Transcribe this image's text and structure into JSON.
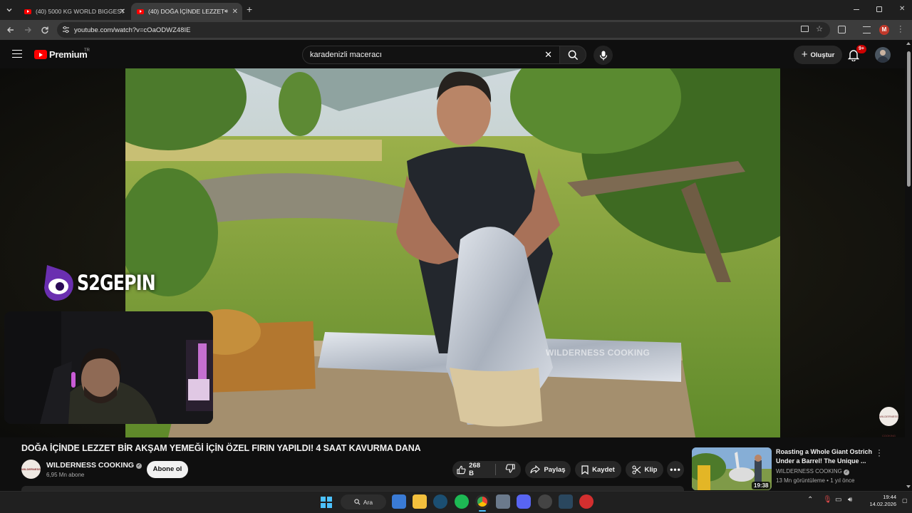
{
  "browser": {
    "tabs": [
      {
        "label": "(40) 5000 KG WORLD BIGGEST",
        "active": false
      },
      {
        "label": "(40) DOĞA İÇİNDE LEZZET",
        "active": true
      }
    ],
    "new_tab": "+",
    "url": "youtube.com/watch?v=cOaODWZ48IE",
    "window_controls": [
      "minimize-icon",
      "restore-icon",
      "close-icon"
    ],
    "profile_initial": "M"
  },
  "youtube": {
    "logo_text": "Premium",
    "region": "TR",
    "search_query": "karadenizli maceracı",
    "create_label": "Oluştur",
    "notification_badge": "9+"
  },
  "video": {
    "watermark": "WILDERNESS COOKING",
    "overlay_name": "S2GEPIN",
    "channel_logo_text": "WILDERNESS COOKING",
    "title": "DOĞA İÇİNDE LEZZET BİR AKŞAM YEMEĞİ İÇİN ÖZEL FIRIN YAPILDI! 4 SAAT KAVURMA DANA",
    "channel": "WILDERNESS COOKING",
    "subscribers": "6,95 Mn abone",
    "subscribe_label": "Abone ol",
    "likes": "268 B",
    "share_label": "Paylaş",
    "save_label": "Kaydet",
    "clip_label": "Klip"
  },
  "recommendation": {
    "title": "Roasting a Whole Giant Ostrich Under a Barrel! The Unique ...",
    "channel": "WILDERNESS COOKING",
    "views": "13 Mn görüntüleme",
    "age": "1 yıl önce",
    "duration": "19:38"
  },
  "taskbar": {
    "search_label": "Ara",
    "time": "19:44",
    "date": "14.02.2026"
  },
  "colors": {
    "accent_red": "#ff0000",
    "background": "#0f0f0f",
    "chip": "#272727"
  }
}
